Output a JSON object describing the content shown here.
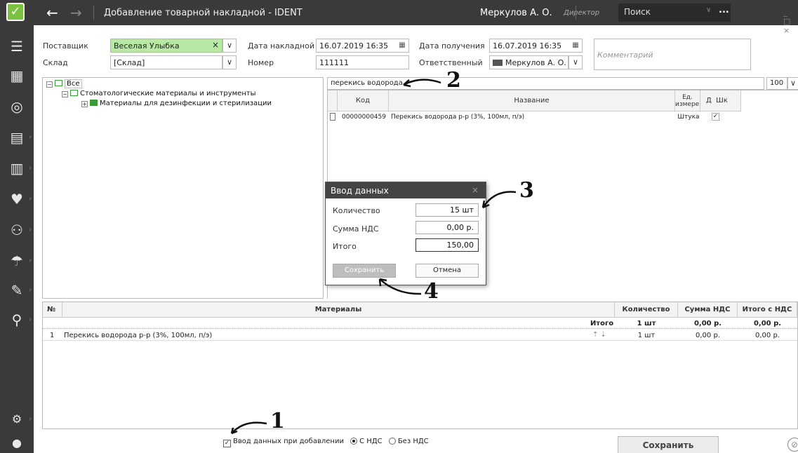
{
  "app": {
    "title": "Добавление товарной накладной - IDENT",
    "user_name": "Меркулов А. О.",
    "user_role": "Директор",
    "search_placeholder": "Поиск",
    "search_more": "...",
    "window_controls": "_ □ ×",
    "accent_color": "#7cc242"
  },
  "sidebar": {
    "icons": [
      "list-icon",
      "calendar-icon",
      "patients-icon",
      "calculator-icon",
      "chart-icon",
      "tooth-icon",
      "people-icon",
      "umbrella-icon",
      "syringe-icon",
      "user-search-icon",
      "settings-icon",
      "person-icon"
    ]
  },
  "form": {
    "supplier_label": "Поставщик",
    "supplier_value": "Веселая Улыбка",
    "clear_glyph": "×",
    "warehouse_label": "Склад",
    "warehouse_value": "[Склад]",
    "invoice_date_label": "Дата накладной",
    "invoice_date_value": "16.07.2019 16:35",
    "number_label": "Номер",
    "number_value": "111111",
    "receive_date_label": "Дата получения",
    "receive_date_value": "16.07.2019 16:35",
    "responsible_label": "Ответственный",
    "responsible_value": "Меркулов А. О.",
    "comment_placeholder": "Комментарий"
  },
  "tree": {
    "root": "Все",
    "items": [
      {
        "label": "Стоматологические материалы и инструменты"
      },
      {
        "label": "Материалы для дезинфекции и стерилизации"
      }
    ]
  },
  "materials": {
    "search_value": "перекись водорода",
    "page_size": "100",
    "columns": {
      "code": "Код",
      "name": "Название",
      "unit": "Ед. измерения",
      "d": "Д",
      "barcode": "Шк"
    },
    "rows": [
      {
        "code": "00000000459",
        "name": "Перекись водорода р-р (3%, 100мл, п/э)",
        "unit": "Штука",
        "checked": "✓"
      }
    ]
  },
  "modal": {
    "title": "Ввод данных",
    "close": "×",
    "qty_label": "Количество",
    "qty_value": "15 шт",
    "vat_label": "Сумма НДС",
    "vat_value": "0,00 р.",
    "total_label": "Итого",
    "total_value": "150,00",
    "save_label": "Сохранить",
    "cancel_label": "Отмена"
  },
  "grid": {
    "columns": {
      "num": "№",
      "materials": "Материалы",
      "qty": "Количество",
      "vat": "Сумма НДС",
      "total": "Итого с НДС"
    },
    "totals": {
      "label": "Итого",
      "qty": "1 шт",
      "vat": "0,00 р.",
      "total": "0,00 р."
    },
    "rows": [
      {
        "num": "1",
        "name": "Перекись водорода р-р (3%, 100мл, п/э)",
        "arrows": "⇡ ⇣",
        "qty": "1 шт",
        "vat": "0,00 р.",
        "total": "0,00 р."
      }
    ]
  },
  "footer": {
    "input_on_add_label": "Ввод данных при добавлении",
    "input_on_add_checked": true,
    "with_vat_label": "С НДС",
    "without_vat_label": "Без НДС",
    "save_label": "Сохранить"
  },
  "annotations": [
    "1",
    "2",
    "3",
    "4"
  ]
}
